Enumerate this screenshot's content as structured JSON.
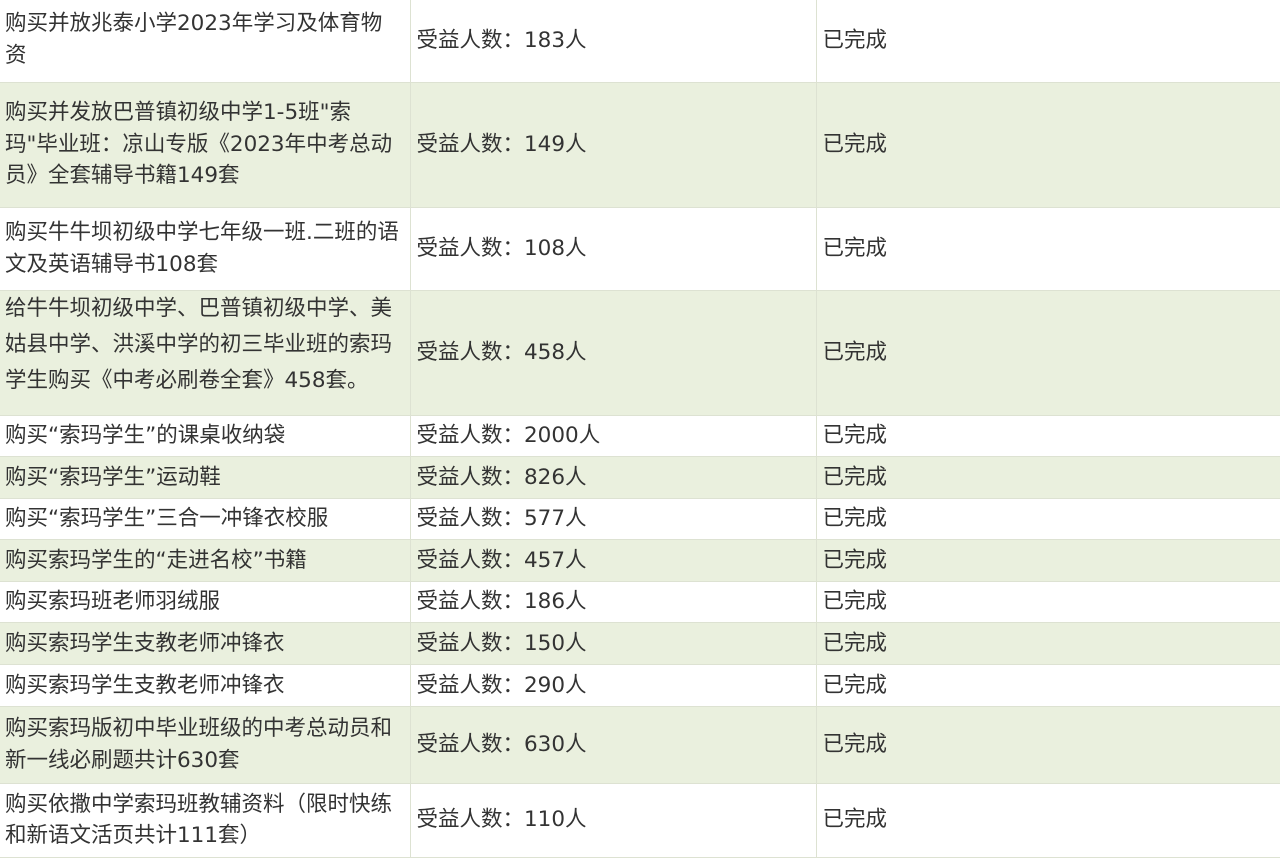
{
  "rows": [
    {
      "item": "购买并放兆泰小学2023年学习及体育物资",
      "beneficiaries": "受益人数：183人",
      "status": "已完成"
    },
    {
      "item": "购买并发放巴普镇初级中学1-5班\"索玛\"毕业班：凉山专版《2023年中考总动员》全套辅导书籍149套",
      "beneficiaries": "受益人数：149人",
      "status": "已完成"
    },
    {
      "item": "购买牛牛坝初级中学七年级一班.二班的语文及英语辅导书108套",
      "beneficiaries": "受益人数：108人",
      "status": "已完成"
    },
    {
      "item": "给牛牛坝初级中学、巴普镇初级中学、美姑县中学、洪溪中学的初三毕业班的索玛学生购买《中考必刷卷全套》458套。",
      "beneficiaries": "受益人数：458人",
      "status": "已完成"
    },
    {
      "item": "购买“索玛学生”的课桌收纳袋",
      "beneficiaries": "受益人数：2000人",
      "status": "已完成"
    },
    {
      "item": "购买“索玛学生”运动鞋",
      "beneficiaries": "受益人数：826人",
      "status": "已完成"
    },
    {
      "item": "购买“索玛学生”三合一冲锋衣校服",
      "beneficiaries": "受益人数：577人",
      "status": "已完成"
    },
    {
      "item": "购买索玛学生的“走进名校”书籍",
      "beneficiaries": "受益人数：457人",
      "status": "已完成"
    },
    {
      "item": "购买索玛班老师羽绒服",
      "beneficiaries": "受益人数：186人",
      "status": "已完成"
    },
    {
      "item": "购买索玛学生支教老师冲锋衣",
      "beneficiaries": "受益人数：150人",
      "status": "已完成"
    },
    {
      "item": "购买索玛学生支教老师冲锋衣",
      "beneficiaries": "受益人数：290人",
      "status": "已完成"
    },
    {
      "item": "购买索玛版初中毕业班级的中考总动员和新一线必刷题共计630套",
      "beneficiaries": "受益人数：630人",
      "status": "已完成"
    },
    {
      "item": "购买依撒中学索玛班教辅资料（限时快练和新语文活页共计111套）",
      "beneficiaries": "受益人数：110人",
      "status": "已完成"
    }
  ]
}
